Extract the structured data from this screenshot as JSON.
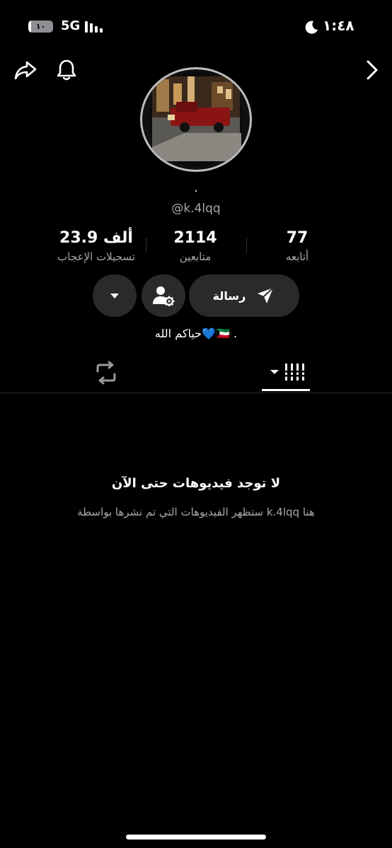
{
  "status_bar": {
    "time": "١:٤٨",
    "network": "5G",
    "battery_level": "١٠",
    "battery_fraction": 0.12
  },
  "top_bar": {
    "icons": [
      "share-icon",
      "bell-icon",
      "back-arrow-icon"
    ]
  },
  "profile": {
    "nickname": ".",
    "username": "@k.4lqq",
    "bio": "حياكم الله💙🇰🇼 ."
  },
  "stats": {
    "likes_value": "23.9 ألف",
    "likes_label": "تسجيلات الإعجاب",
    "followers_value": "2114",
    "followers_label": "متابعين",
    "following_value": "77",
    "following_label": "أتابعه"
  },
  "actions": {
    "message_label": "رسالة",
    "icons": [
      "send-icon",
      "user-settings-icon",
      "dropdown-arrow-icon"
    ]
  },
  "tabs": {
    "active": "videos",
    "icons": [
      "repost-icon",
      "videos-grid-icon"
    ]
  },
  "empty_state": {
    "title": "لا توجد فيديوهات حتى الآن",
    "subtitle": "ستظهر الفيديوهات التي تم نشرها بواسطة k.4lqq هنا"
  }
}
